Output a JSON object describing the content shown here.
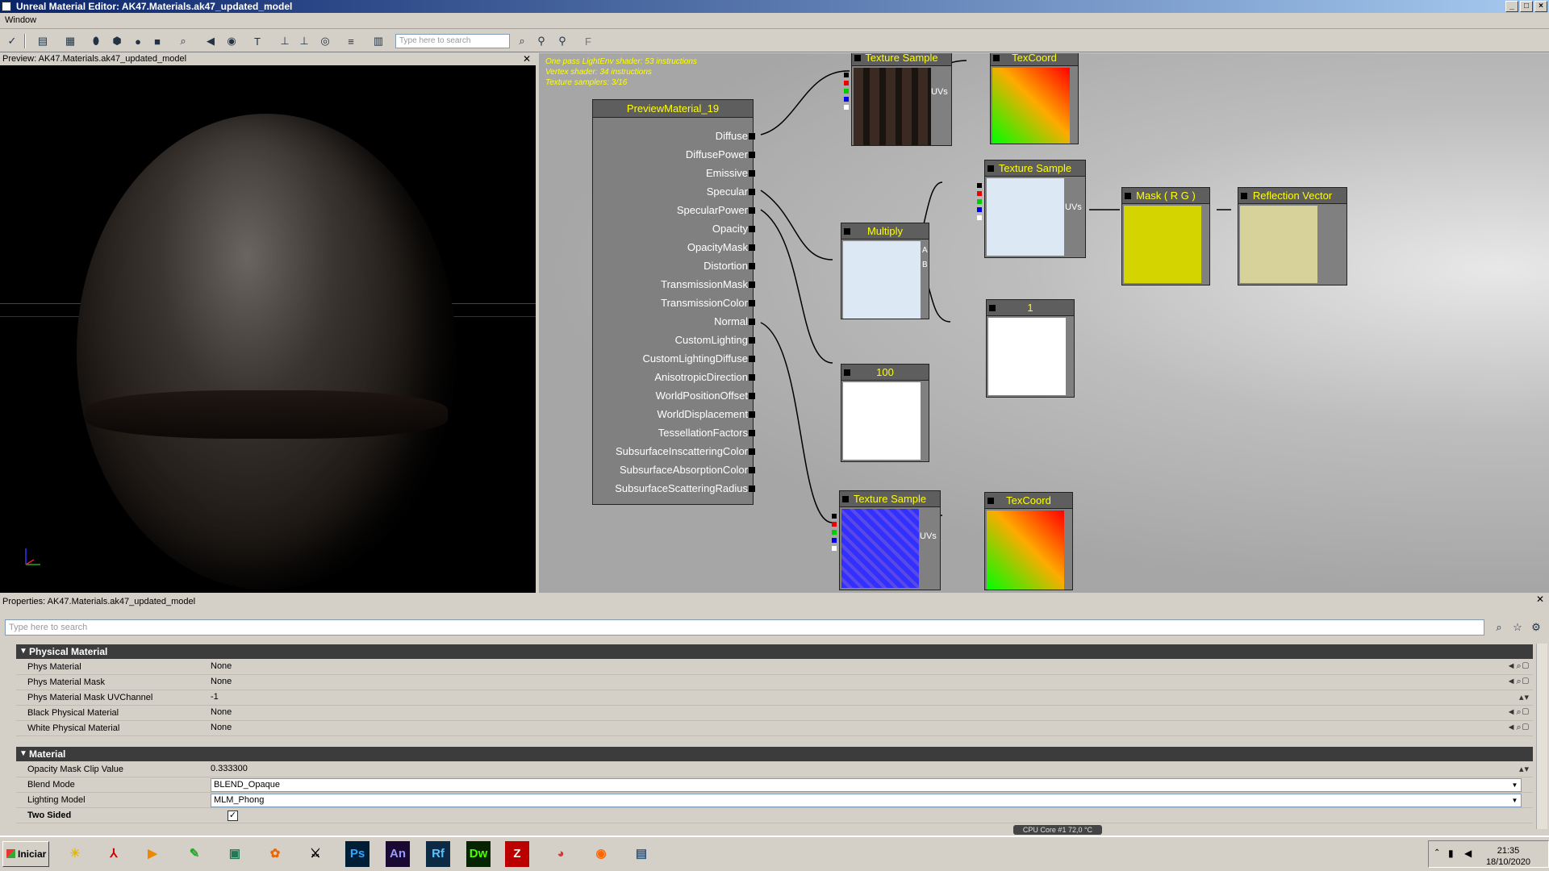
{
  "window": {
    "title": "Unreal Material Editor: AK47.Materials.ak47_updated_model"
  },
  "menu": {
    "window_label": "Window"
  },
  "toolbar": {
    "search_placeholder": "Type here to search"
  },
  "preview": {
    "header": "Preview: AK47.Materials.ak47_updated_model",
    "close": "✕"
  },
  "graph": {
    "stats": [
      "One pass LightEnv shader: 53 instructions",
      "Vertex shader: 34 instructions",
      "Texture samplers: 3/16"
    ],
    "material_node": {
      "title": "PreviewMaterial_19",
      "inputs": [
        "Diffuse",
        "DiffusePower",
        "Emissive",
        "Specular",
        "SpecularPower",
        "Opacity",
        "OpacityMask",
        "Distortion",
        "TransmissionMask",
        "TransmissionColor",
        "Normal",
        "CustomLighting",
        "CustomLightingDiffuse",
        "AnisotropicDirection",
        "WorldPositionOffset",
        "WorldDisplacement",
        "TessellationFactors",
        "SubsurfaceInscatteringColor",
        "SubsurfaceAbsorptionColor",
        "SubsurfaceScatteringRadius"
      ]
    },
    "nodes": {
      "tex1": "Texture Sample",
      "texcoord1": "TexCoord",
      "tex2": "Texture Sample",
      "multiply": "Multiply",
      "mask": "Mask ( R G )",
      "reflection": "Reflection Vector",
      "const1": "1",
      "const100": "100",
      "tex3": "Texture Sample",
      "texcoord2": "TexCoord"
    },
    "pin_labels": {
      "uvs": "UVs",
      "a": "A",
      "b": "B"
    }
  },
  "properties": {
    "header": "Properties: AK47.Materials.ak47_updated_model",
    "close": "✕",
    "search_placeholder": "Type here to search",
    "categories": [
      {
        "name": "Physical Material",
        "rows": [
          {
            "name": "Phys Material",
            "value": "None"
          },
          {
            "name": "Phys Material Mask",
            "value": "None"
          },
          {
            "name": "Phys Material Mask UVChannel",
            "value": "-1"
          },
          {
            "name": "Black Physical Material",
            "value": "None"
          },
          {
            "name": "White Physical Material",
            "value": "None"
          }
        ]
      },
      {
        "name": "Material",
        "rows": [
          {
            "name": "Opacity Mask Clip Value",
            "value": "0.333300"
          },
          {
            "name": "Blend Mode",
            "value": "BLEND_Opaque"
          },
          {
            "name": "Lighting Model",
            "value": "MLM_Phong"
          },
          {
            "name": "Two Sided",
            "value": "✓"
          }
        ]
      }
    ],
    "cpu_readout": "CPU Core #1     72,0 °C"
  },
  "taskbar": {
    "start_label": "Iniciar",
    "apps": [
      "Ps",
      "An",
      "Rf",
      "Dw"
    ],
    "time": "21:35",
    "date": "18/10/2020"
  },
  "colors": {
    "node_title_text": "#ffff00",
    "stats_text": "#ffff00",
    "titlebar": "#0a246a"
  }
}
